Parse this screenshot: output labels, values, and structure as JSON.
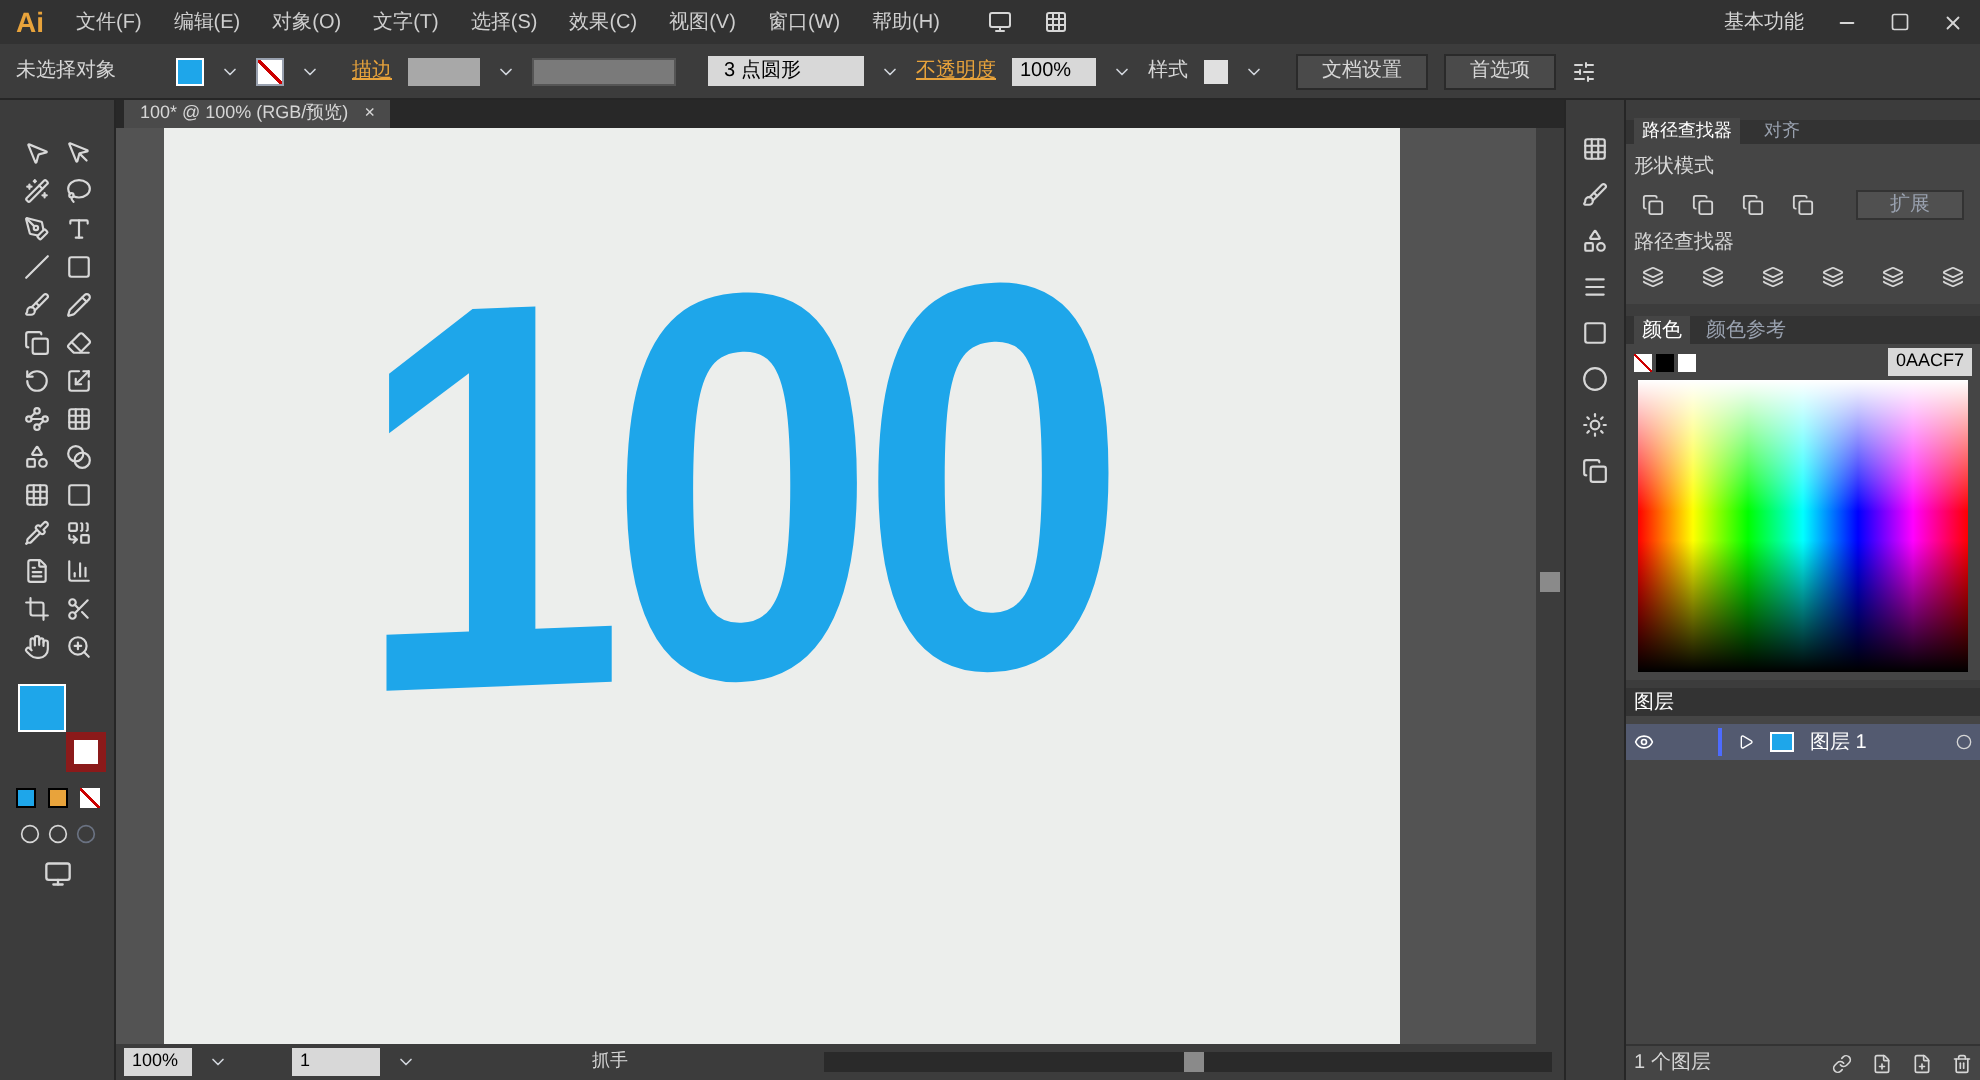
{
  "app": {
    "logo": "Ai",
    "menus": [
      "文件(F)",
      "编辑(E)",
      "对象(O)",
      "文字(T)",
      "选择(S)",
      "效果(C)",
      "视图(V)",
      "窗口(W)",
      "帮助(H)"
    ],
    "workspace": "基本功能"
  },
  "control_bar": {
    "selection": "未选择对象",
    "stroke_label": "描边",
    "brush": "3 点圆形",
    "opacity_label": "不透明度",
    "opacity": "100%",
    "style_label": "样式",
    "doc_setup": "文档设置",
    "preferences": "首选项"
  },
  "document_tab": {
    "title": "100* @ 100% (RGB/预览)",
    "close": "×"
  },
  "artwork": {
    "text": "100"
  },
  "pathfinder_panel": {
    "tabs": [
      {
        "label": "路径查找器",
        "selected": true
      },
      {
        "label": "对齐",
        "selected": false
      }
    ],
    "shape_modes_label": "形状模式",
    "expand": "扩展",
    "pathfinders_label": "路径查找器"
  },
  "color_panel": {
    "tabs": [
      {
        "label": "颜色",
        "selected": true
      },
      {
        "label": "颜色参考",
        "selected": false
      }
    ],
    "hex": "0AACF7"
  },
  "layers_panel": {
    "tab": "图层",
    "layers": [
      {
        "name": "图层 1",
        "visible": true,
        "expanded": false
      }
    ],
    "footer": "1 个图层"
  },
  "status_bar": {
    "zoom": "100%",
    "page": "1",
    "tool": "抓手"
  }
}
